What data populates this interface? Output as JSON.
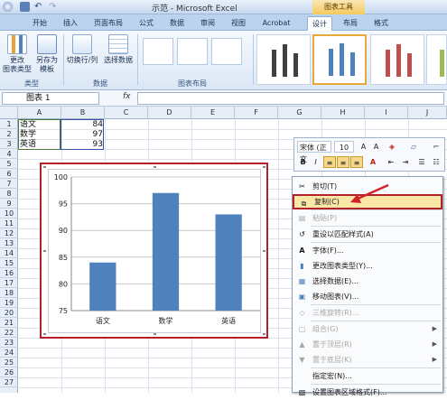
{
  "window": {
    "title": "示范 - Microsoft Excel",
    "chart_tools_label": "图表工具"
  },
  "tabs": [
    "开始",
    "插入",
    "页面布局",
    "公式",
    "数据",
    "审阅",
    "视图",
    "Acrobat",
    "设计",
    "布局",
    "格式"
  ],
  "active_tab": "设计",
  "ribbon": {
    "type_group": {
      "label": "类型",
      "buttons": [
        {
          "label": "更改\n图表类型",
          "icon": "chart-type-icon"
        },
        {
          "label": "另存为\n模板",
          "icon": "save-template-icon"
        }
      ]
    },
    "data_group": {
      "label": "数据",
      "buttons": [
        {
          "label": "切换行/列",
          "icon": "switch-row-col-icon"
        },
        {
          "label": "选择数据",
          "icon": "select-data-icon"
        }
      ]
    },
    "layout_group": {
      "label": "图表布局"
    }
  },
  "formula_bar": {
    "name_box": "图表 1",
    "fx_label": "fx",
    "formula": ""
  },
  "columns": [
    "A",
    "B",
    "C",
    "D",
    "E",
    "F",
    "G",
    "H",
    "I",
    "J"
  ],
  "rows": [
    "1",
    "2",
    "3",
    "4",
    "5",
    "6",
    "7",
    "8",
    "9",
    "10",
    "11",
    "12",
    "13",
    "14",
    "15",
    "16",
    "17",
    "18",
    "19",
    "20",
    "21",
    "22",
    "23",
    "24",
    "25",
    "26",
    "27"
  ],
  "cells": [
    {
      "label": "语文",
      "value": "84"
    },
    {
      "label": "数学",
      "value": "97"
    },
    {
      "label": "英语",
      "value": "93"
    }
  ],
  "chart_data": {
    "type": "bar",
    "categories": [
      "语文",
      "数学",
      "英语"
    ],
    "values": [
      84,
      97,
      93
    ],
    "yticks": [
      "75",
      "80",
      "85",
      "90",
      "95",
      "100"
    ],
    "ylim": [
      75,
      100
    ],
    "title": "",
    "xlabel": "",
    "ylabel": "",
    "bar_color": "#4f81bd",
    "grid": true
  },
  "mini_toolbar": {
    "font": "宋体 (正文",
    "size": "10",
    "bold": "B",
    "italic": "I",
    "font_color_icon": "A"
  },
  "context_menu": [
    {
      "label": "剪切(T)",
      "icon": "cut-icon",
      "glyph": "✂",
      "disabled": false
    },
    {
      "label": "复制(C)",
      "icon": "copy-icon",
      "glyph": "⧉",
      "disabled": false,
      "highlighted": true
    },
    {
      "label": "粘贴(P)",
      "icon": "paste-icon",
      "glyph": "▤",
      "disabled": true
    },
    {
      "label": "重设以匹配样式(A)",
      "icon": "reset-style-icon",
      "glyph": "↺",
      "disabled": false
    },
    {
      "label": "字体(F)...",
      "icon": "font-icon",
      "glyph": "A",
      "disabled": false
    },
    {
      "label": "更改图表类型(Y)...",
      "icon": "chart-type-icon",
      "glyph": "▮",
      "disabled": false
    },
    {
      "label": "选择数据(E)...",
      "icon": "select-data-icon",
      "glyph": "▦",
      "disabled": false
    },
    {
      "label": "移动图表(V)...",
      "icon": "move-chart-icon",
      "glyph": "▣",
      "disabled": false
    },
    {
      "label": "三维旋转(R)...",
      "icon": "rotate-3d-icon",
      "glyph": "◇",
      "disabled": true
    },
    {
      "label": "组合(G)",
      "icon": "group-icon",
      "glyph": "▢",
      "disabled": true,
      "submenu": true
    },
    {
      "label": "置于顶层(R)",
      "icon": "bring-front-icon",
      "glyph": "▲",
      "disabled": true,
      "submenu": true
    },
    {
      "label": "置于底层(K)",
      "icon": "send-back-icon",
      "glyph": "▼",
      "disabled": true,
      "submenu": true
    },
    {
      "label": "指定宏(N)...",
      "icon": "macro-icon",
      "glyph": "",
      "disabled": false
    },
    {
      "label": "设置图表区域格式(F)...",
      "icon": "format-area-icon",
      "glyph": "▧",
      "disabled": false
    }
  ],
  "colors": {
    "accent_red": "#b3222a",
    "menu_highlight": "#fbe8a6",
    "bar": "#4f81bd"
  }
}
